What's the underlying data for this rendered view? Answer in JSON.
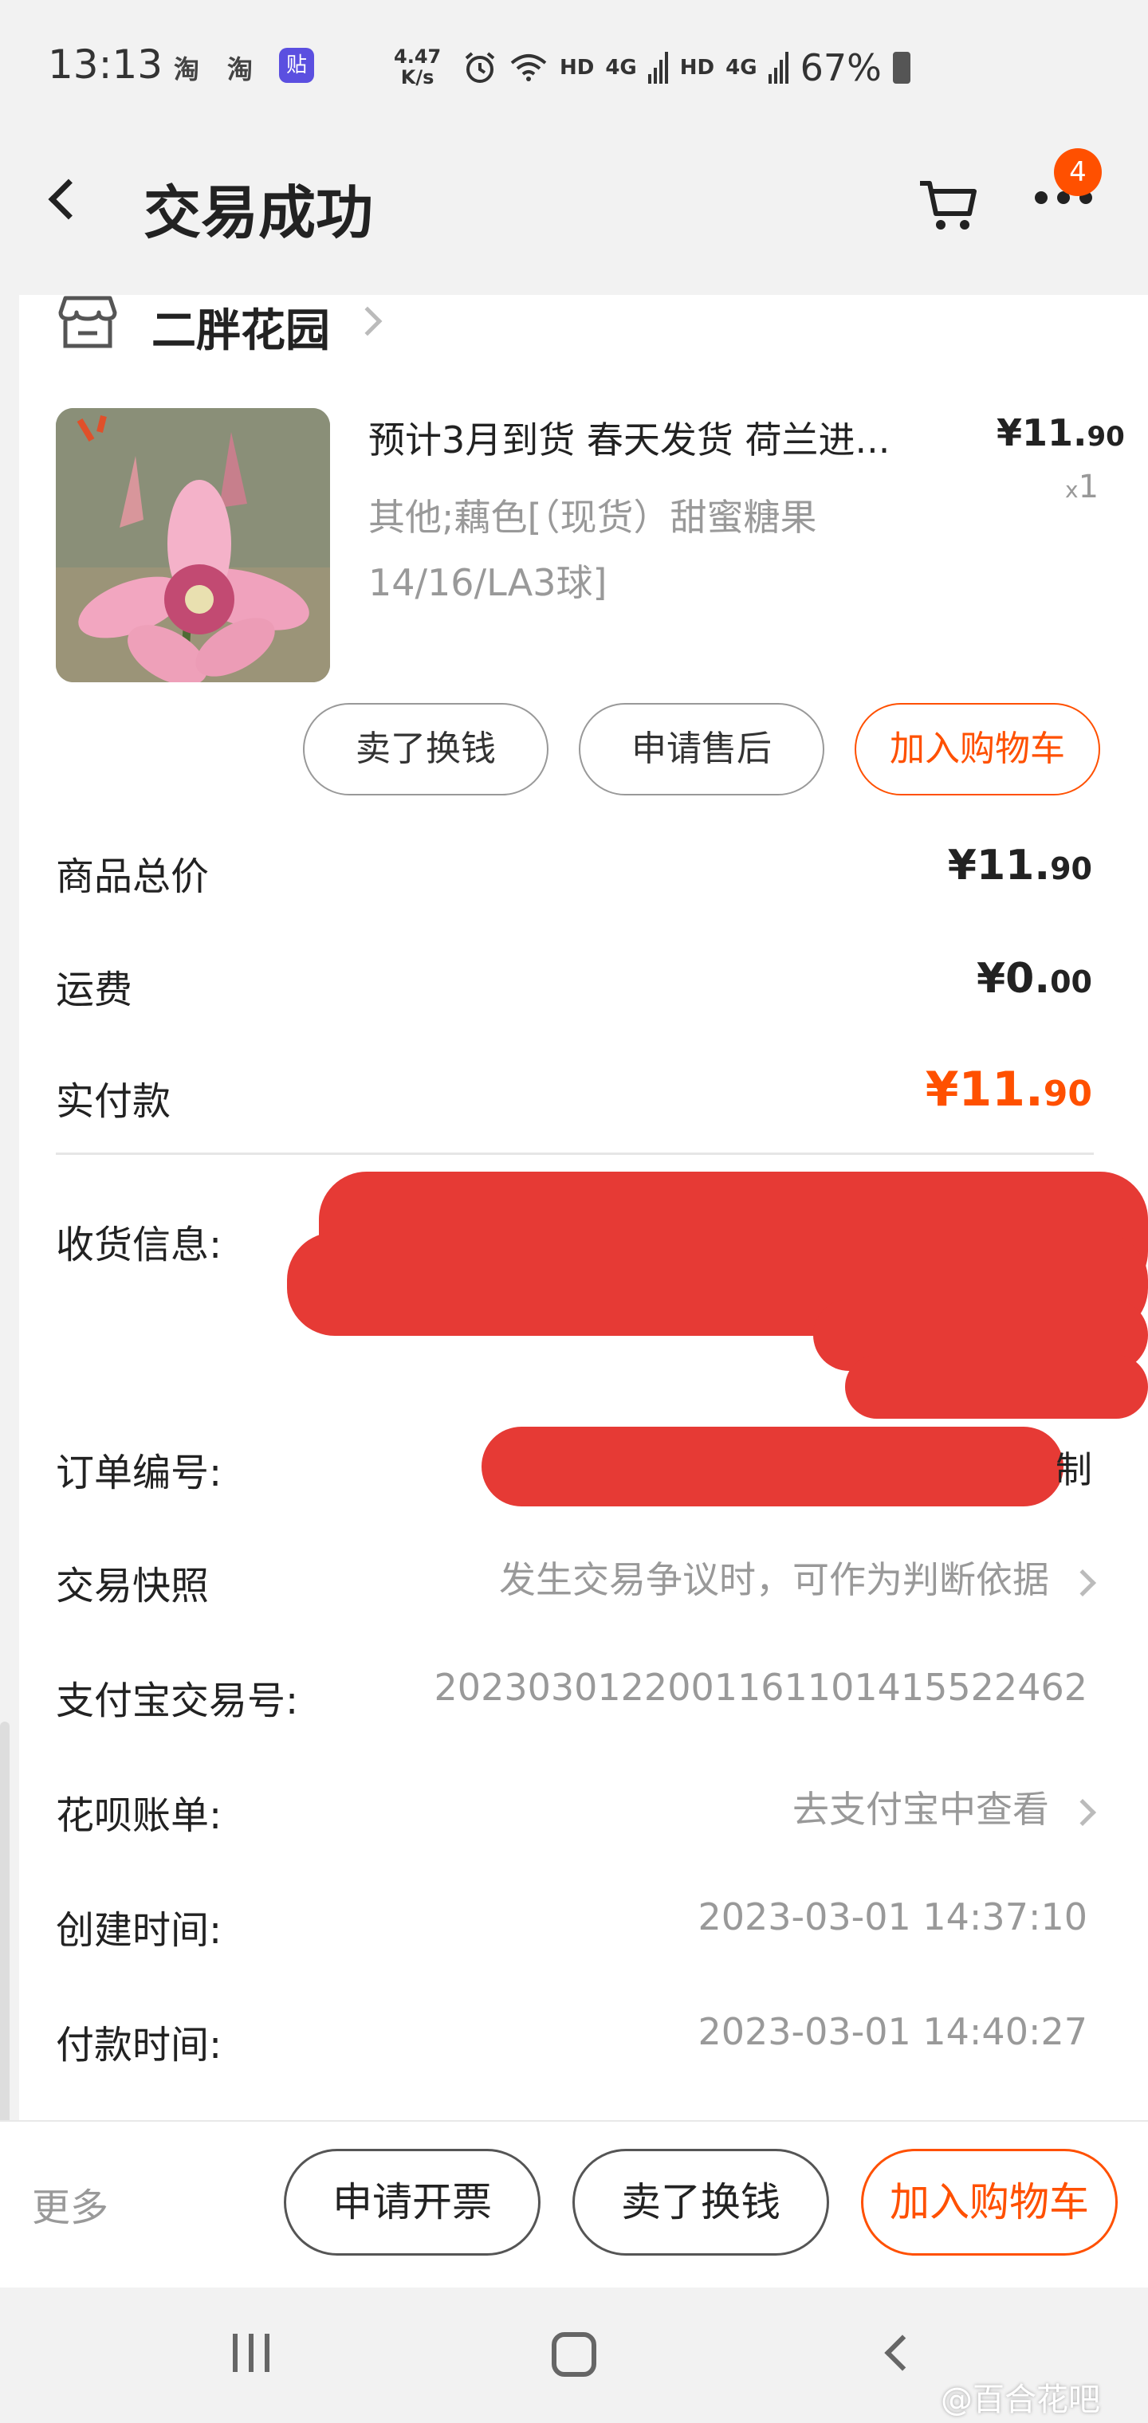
{
  "status_bar": {
    "time": "13:13",
    "app_icons": [
      "淘",
      "淘"
    ],
    "tieba_icon": "贴",
    "net_speed": "4.47",
    "net_speed_unit": "K/s",
    "net_labels": [
      "HD",
      "4G",
      "HD",
      "4G"
    ],
    "battery": "67%"
  },
  "header": {
    "title": "交易成功",
    "more_badge": "4"
  },
  "shop": {
    "name": "二胖花园"
  },
  "product": {
    "title": "预计3月到货 春天发货 荷兰进...",
    "spec": "其他;藕色[（现货）甜蜜糖果 14/16/LA3球]",
    "price_main": "¥11.",
    "price_decimal": "90",
    "qty_prefix": "x",
    "qty": "1",
    "actions": [
      "卖了换钱",
      "申请售后",
      "加入购物车"
    ]
  },
  "summary": {
    "total_label": "商品总价",
    "total_main": "¥11.",
    "total_decimal": "90",
    "shipping_label": "运费",
    "shipping_main": "¥0.",
    "shipping_decimal": "00",
    "paid_label": "实付款",
    "paid_main": "¥11.",
    "paid_decimal": "90"
  },
  "info": {
    "receiver_label": "收货信息:",
    "order_no_label": "订单编号:",
    "order_no_suffix": "制",
    "snapshot_label": "交易快照",
    "snapshot_value": "发生交易争议时，可作为判断依据",
    "alipay_label": "支付宝交易号:",
    "alipay_value": "2023030122001161101415522462",
    "huabei_label": "花呗账单:",
    "huabei_value": "去支付宝中查看",
    "created_label": "创建时间:",
    "created_value": "2023-03-01 14:37:10",
    "paid_time_label": "付款时间:",
    "paid_time_value": "2023-03-01 14:40:27"
  },
  "bottom_bar": {
    "more": "更多",
    "buttons": [
      "申请开票",
      "卖了换钱",
      "加入购物车"
    ]
  },
  "watermark": "@百合花吧",
  "colors": {
    "accent": "#ff5000",
    "redaction": "#e63a35",
    "background": "#f2f2f2"
  }
}
